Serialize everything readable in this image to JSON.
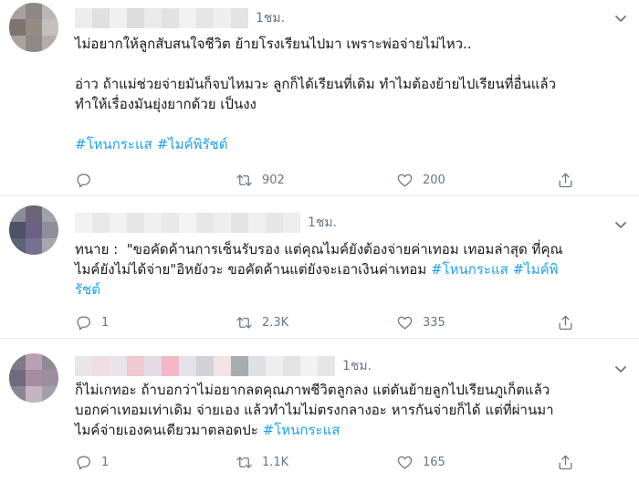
{
  "tweets": [
    {
      "time": "1ชม.",
      "text_a": "ไม่อยากให้ลูกสับสนใจชีวิต ย้ายโรงเรียนไปมา เพราะพ่อจ่ายไม่ไหว..\n\nอ่าว ถ้าแม่ช่วยจ่ายมันก็จบไหมวะ ลูกก็ได้เรียนที่เดิม ทำไมต้องย้ายไปเรียนที่อื่นแล้ว\nทำให้เรื่องมันยุ่งยากด้วย เป็นงง\n\n",
      "hashtag_1": "#โหนกระแส",
      "text_b": " ",
      "hashtag_2": "#ไมค์พิรัชต์",
      "replies": "",
      "retweets": "902",
      "likes": "200"
    },
    {
      "time": "1ชม.",
      "text_a": "ทนาย :  \"ขอคัดค้านการเซ็นรับรอง แต่คุณไมค์ยังต้องจ่ายค่าเทอม เทอมล่าสุด ที่คุณ\nไมค์ยังไม่ได้จ่าย\"อิหยังวะ ขอคัดค้านแต่ยังจะเอาเงินค่าเทอม ",
      "hashtag_1": "#โหนกระแส",
      "text_b": " ",
      "hashtag_2": "#ไมค์พิ\nรัชต์",
      "replies": "1",
      "retweets": "2.3K",
      "likes": "335"
    },
    {
      "time": "1ชม.",
      "text_a": "ก็ไม่เกทอะ ถ้าบอกว่าไม่อยากลดคุณภาพชีวิตลูกลง แต่ดันย้ายลูกไปเรียนภูเก็ตแล้ว\nบอกค่าเทอมเท่าเดิม จ่ายเอง แล้วทำไมไม่ตรงกลางอะ หารกันจ่ายก็ได้ แต่ที่ผ่านมา\nไมค์จ่ายเองคนเดียวมาตลอดปะ ",
      "hashtag_1": "#โหนกระแส",
      "text_b": "",
      "hashtag_2": "",
      "replies": "1",
      "retweets": "1.1K",
      "likes": "165"
    }
  ],
  "icons": {
    "reply": "reply-icon",
    "retweet": "retweet-icon",
    "like": "heart-icon",
    "share": "share-icon",
    "more": "chevron-down-icon"
  },
  "colors": {
    "hashtag": "#1da1f2",
    "meta": "#657786",
    "divider": "#e6ecf0"
  }
}
